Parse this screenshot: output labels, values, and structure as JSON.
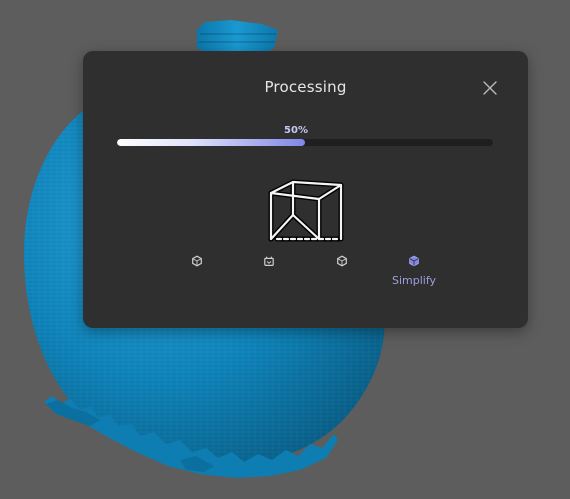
{
  "dialog": {
    "title": "Processing",
    "close_icon": "close-icon",
    "progress": {
      "value": 0.5,
      "label": "50%"
    },
    "status_icon": "cube-wireframe-icon",
    "steps": [
      {
        "icon": "step-icon-1",
        "label": "",
        "active": false
      },
      {
        "icon": "step-icon-2",
        "label": "",
        "active": false
      },
      {
        "icon": "step-icon-3",
        "label": "",
        "active": false
      },
      {
        "icon": "step-icon-4",
        "label": "Simplify",
        "active": true
      }
    ]
  },
  "colors": {
    "background": "#5d5d5d",
    "model": "#0f86bd",
    "dialog": "#2f2f2f",
    "accent": "#7f86e6",
    "active_label": "#9aa0dc"
  }
}
